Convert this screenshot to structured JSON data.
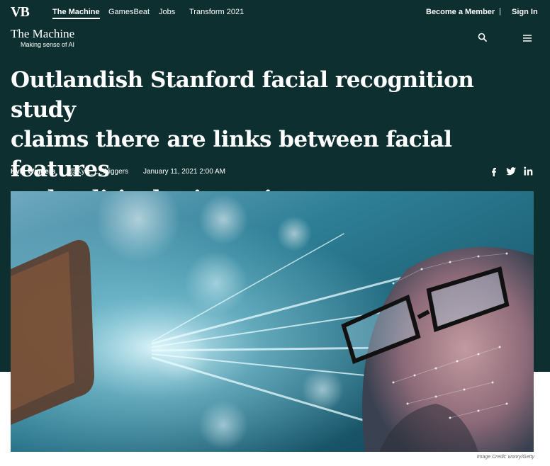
{
  "nav": {
    "logo": "VB",
    "links": [
      "The Machine",
      "GamesBeat",
      "Jobs",
      "Transform 2021"
    ],
    "become_member": "Become a Member",
    "separator": "|",
    "sign_in": "Sign In"
  },
  "section": {
    "title": "The Machine",
    "tagline": "Making sense of AI"
  },
  "article": {
    "headline_lines": [
      "Outlandish Stanford facial recognition study",
      "claims there are links between facial features",
      "and political orientation"
    ],
    "author": "Kyle Wiggers",
    "handle": "@Kyle_L_Wiggers",
    "date": "January 11, 2021 2:00 AM",
    "share": [
      "facebook-icon",
      "twitter-icon",
      "linkedin-icon"
    ],
    "image_credit": "Image Credit: wonry/Getty"
  },
  "colors": {
    "hero_background": "#0d2f30",
    "text": "#ffffff"
  }
}
